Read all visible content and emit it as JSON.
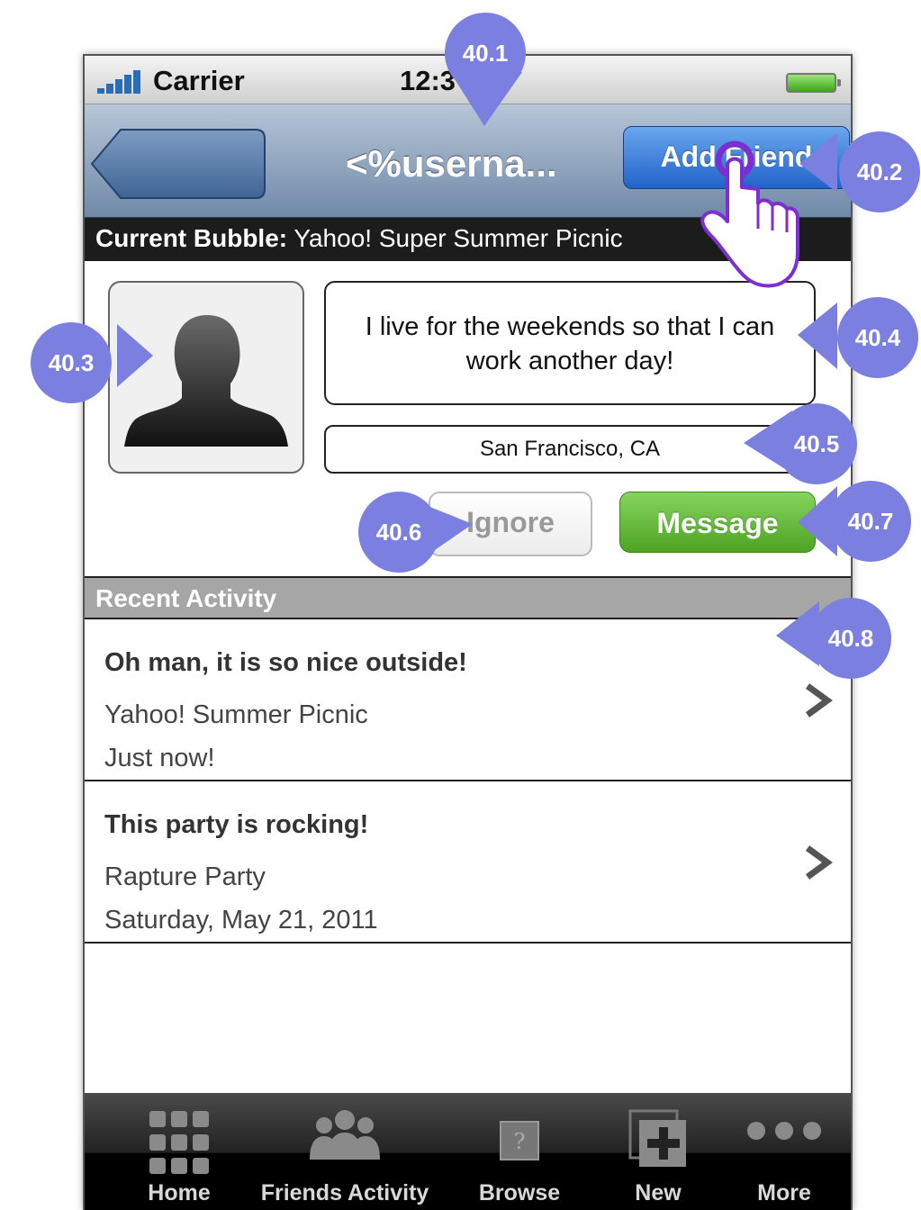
{
  "status_bar": {
    "carrier": "Carrier",
    "time": "12:3"
  },
  "nav": {
    "title": "<%userna...",
    "add_friend_label": "Add Friend"
  },
  "current_bubble": {
    "label": "Current Bubble:",
    "value": "Yahoo! Super Summer Picnic"
  },
  "profile": {
    "quote": "I live for the weekends so that I can work another day!",
    "location": "San Francisco, CA",
    "ignore_label": "Ignore",
    "message_label": "Message"
  },
  "recent_activity": {
    "header": "Recent Activity",
    "items": [
      {
        "title": "Oh man, it is so nice outside!",
        "event": "Yahoo! Summer Picnic",
        "time": "Just now!"
      },
      {
        "title": "This party is rocking!",
        "event": "Rapture Party",
        "time": "Saturday, May 21, 2011"
      }
    ]
  },
  "tab_bar": {
    "items": [
      {
        "label": "Home",
        "icon": "grid-icon"
      },
      {
        "label": "Friends Activity",
        "icon": "people-icon"
      },
      {
        "label": "Browse",
        "icon": "question-box-icon"
      },
      {
        "label": "New",
        "icon": "plus-square-icon"
      },
      {
        "label": "More",
        "icon": "ellipsis-icon"
      }
    ]
  },
  "annotations": [
    "40.1",
    "40.2",
    "40.3",
    "40.4",
    "40.5",
    "40.6",
    "40.7",
    "40.8"
  ],
  "colors": {
    "callout": "#7b80e0",
    "nav_button": "#2f74d6",
    "message_button": "#5cb832",
    "tab_bar": "#000000"
  }
}
